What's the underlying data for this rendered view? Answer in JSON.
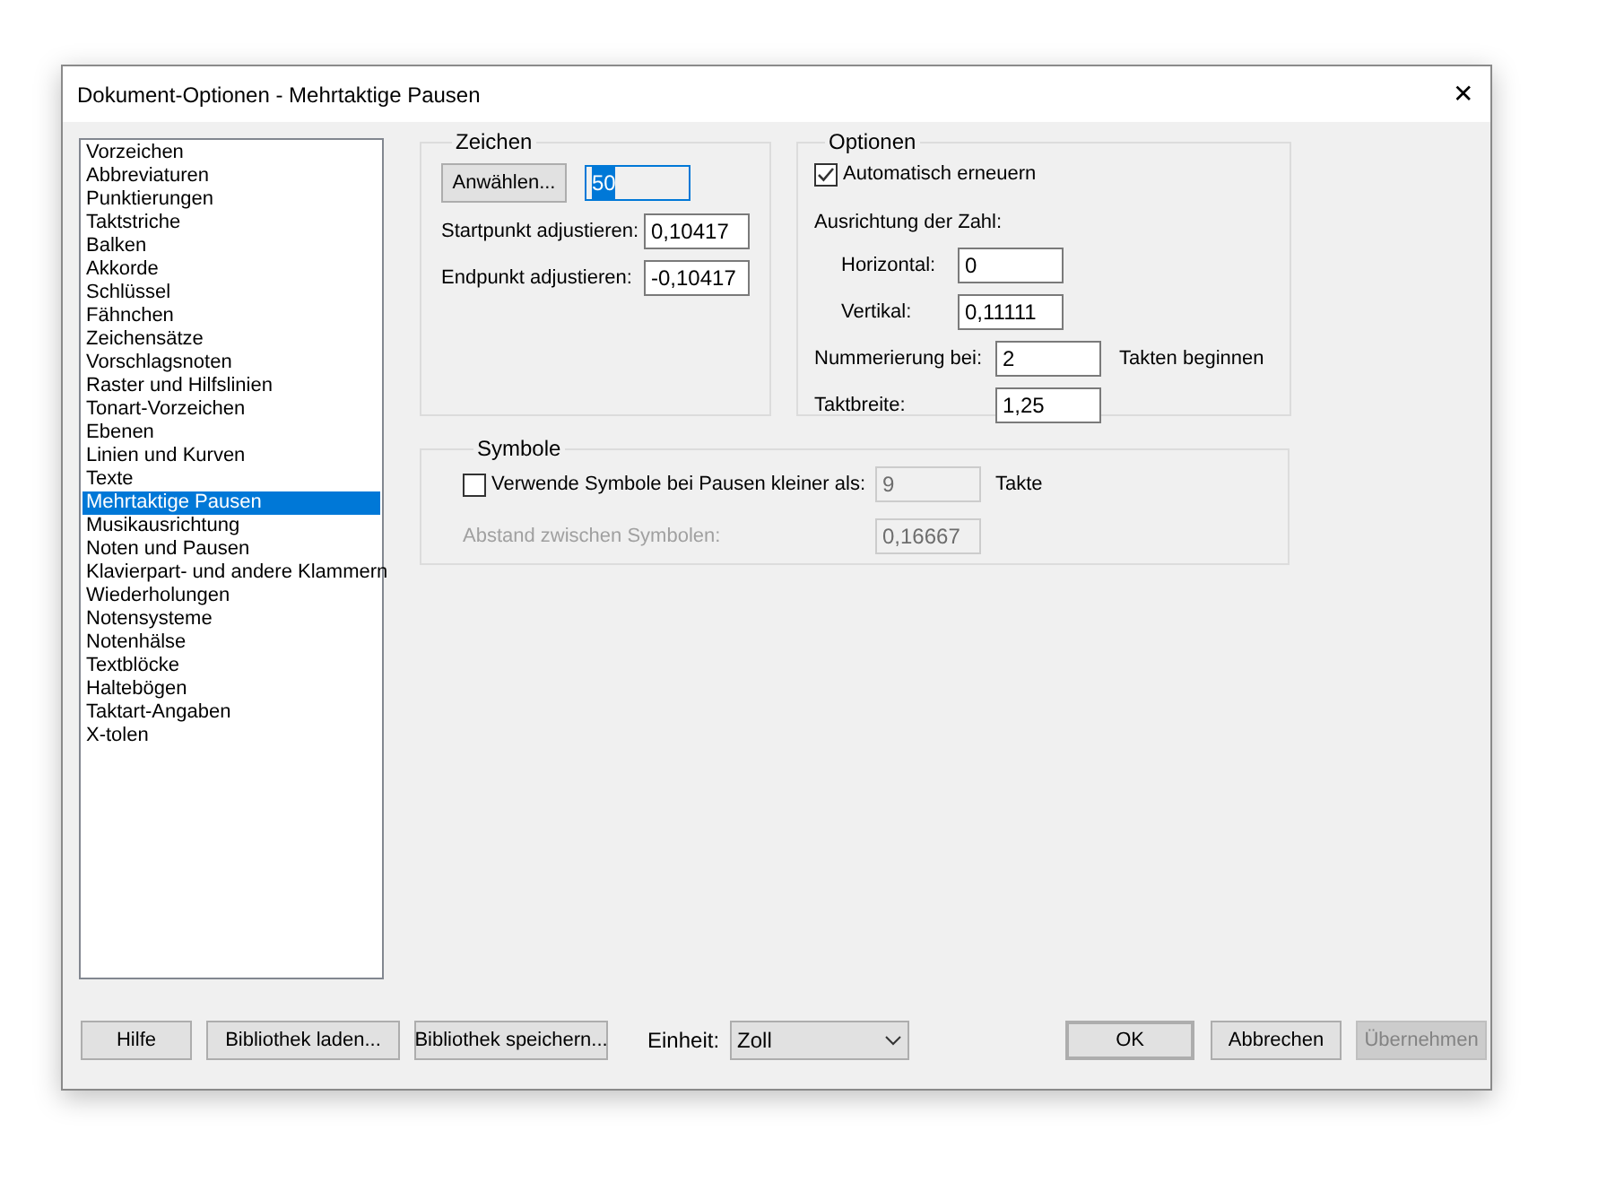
{
  "window": {
    "title": "Dokument-Optionen - Mehrtaktige Pausen",
    "close": "✕"
  },
  "sidebar": {
    "items": [
      {
        "label": "Vorzeichen",
        "selected": false
      },
      {
        "label": "Abbreviaturen",
        "selected": false
      },
      {
        "label": "Punktierungen",
        "selected": false
      },
      {
        "label": "Taktstriche",
        "selected": false
      },
      {
        "label": "Balken",
        "selected": false
      },
      {
        "label": "Akkorde",
        "selected": false
      },
      {
        "label": "Schlüssel",
        "selected": false
      },
      {
        "label": "Fähnchen",
        "selected": false
      },
      {
        "label": "Zeichensätze",
        "selected": false
      },
      {
        "label": "Vorschlagsnoten",
        "selected": false
      },
      {
        "label": "Raster und Hilfslinien",
        "selected": false
      },
      {
        "label": "Tonart-Vorzeichen",
        "selected": false
      },
      {
        "label": "Ebenen",
        "selected": false
      },
      {
        "label": "Linien und Kurven",
        "selected": false
      },
      {
        "label": "Texte",
        "selected": false
      },
      {
        "label": "Mehrtaktige Pausen",
        "selected": true
      },
      {
        "label": "Musikausrichtung",
        "selected": false
      },
      {
        "label": "Noten und Pausen",
        "selected": false
      },
      {
        "label": "Klavierpart- und andere Klammern",
        "selected": false
      },
      {
        "label": "Wiederholungen",
        "selected": false
      },
      {
        "label": "Notensysteme",
        "selected": false
      },
      {
        "label": "Notenhälse",
        "selected": false
      },
      {
        "label": "Textblöcke",
        "selected": false
      },
      {
        "label": "Haltebögen",
        "selected": false
      },
      {
        "label": "Taktart-Angaben",
        "selected": false
      },
      {
        "label": "X-tolen",
        "selected": false
      }
    ]
  },
  "zeichen": {
    "title": "Zeichen",
    "select_button": "Anwählen...",
    "value": "50",
    "value_selected": true,
    "fields": [
      {
        "label": "Startpunkt adjustieren:",
        "value": "0,10417"
      },
      {
        "label": "Endpunkt adjustieren:",
        "value": "-0,10417"
      }
    ]
  },
  "optionen": {
    "title": "Optionen",
    "auto_checkbox": {
      "label": "Automatisch erneuern",
      "checked": true
    },
    "alignment_label": "Ausrichtung der Zahl:",
    "alignment_fields": [
      {
        "label": "Horizontal:",
        "value": "0"
      },
      {
        "label": "Vertikal:",
        "value": "0,11111"
      }
    ],
    "numbering": {
      "label": "Nummerierung bei:",
      "value": "2",
      "suffix": "Takten beginnen"
    },
    "bar_width": {
      "label": "Taktbreite:",
      "value": "1,25"
    }
  },
  "symbole": {
    "title": "Symbole",
    "checkbox": {
      "label": "Verwende Symbole bei Pausen kleiner als:",
      "checked": false,
      "value": "9",
      "suffix": "Takte"
    },
    "spacing": {
      "label": "Abstand zwischen Symbolen:",
      "value": "0,16667"
    },
    "disabled": true
  },
  "footer": {
    "buttons": [
      "Hilfe",
      "Bibliothek laden...",
      "Bibliothek speichern..."
    ],
    "unit": {
      "label": "Einheit:",
      "value": "Zoll"
    },
    "ok": "OK",
    "cancel": "Abbrechen",
    "apply": {
      "label": "Übernehmen",
      "disabled": true
    }
  }
}
